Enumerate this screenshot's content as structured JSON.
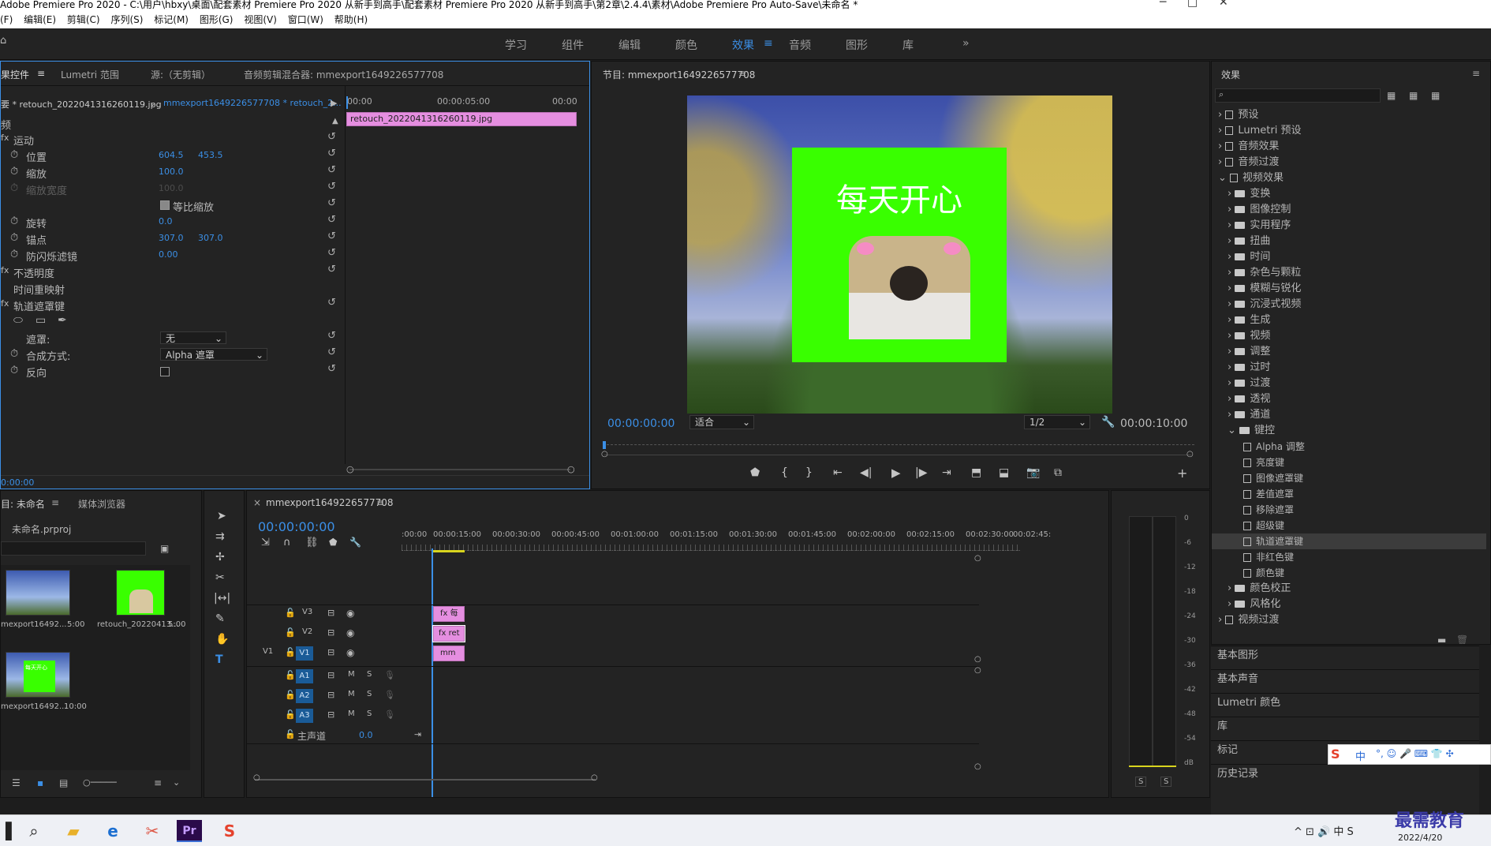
{
  "window": {
    "title": "Adobe Premiere Pro 2020 - C:\\用户\\hbxy\\桌面\\配套素材 Premiere Pro 2020 从新手到高手\\配套素材 Premiere Pro 2020 从新手到高手\\第2章\\2.4.4\\素材\\Adobe Premiere Pro Auto-Save\\未命名 *"
  },
  "menu": [
    "(F)",
    "编辑(E)",
    "剪辑(C)",
    "序列(S)",
    "标记(M)",
    "图形(G)",
    "视图(V)",
    "窗口(W)",
    "帮助(H)"
  ],
  "workspaces": [
    "学习",
    "组件",
    "编辑",
    "颜色",
    "效果",
    "音频",
    "图形",
    "库"
  ],
  "workspace_active": "效果",
  "effect_controls": {
    "tabs": [
      "果控件",
      "Lumetri 范围",
      "源:（无剪辑）",
      "音频剪辑混合器: mmexport1649226577708"
    ],
    "source_clip": "要 * retouch_2022041316260119.jpg",
    "sequence_clip": "mmexport1649226577708 * retouch_2...",
    "section": "频",
    "timeline_start": "00:00",
    "timeline_mid": "00:00:05:00",
    "timeline_end": "00:00",
    "clip_label": "retouch_2022041316260119.jpg",
    "timecode": "0:00:00",
    "props": {
      "motion": "运动",
      "position": "位置",
      "pos_x": "604.5",
      "pos_y": "453.5",
      "scale": "缩放",
      "scale_val": "100.0",
      "scale_width": "缩放宽度",
      "scale_width_val": "100.0",
      "uniform": "等比缩放",
      "rotation": "旋转",
      "rotation_val": "0.0",
      "anchor": "锚点",
      "anchor_x": "307.0",
      "anchor_y": "307.0",
      "flicker": "防闪烁滤镜",
      "flicker_val": "0.00",
      "opacity": "不透明度",
      "time_remap": "时间重映射",
      "track_matte": "轨道遮罩键",
      "mask": "遮罩:",
      "mask_val": "无",
      "composite": "合成方式:",
      "composite_val": "Alpha 遮罩",
      "reverse": "反向"
    }
  },
  "program": {
    "title": "节目: mmexport1649226577708",
    "overlay_text": "每天开心",
    "timecode": "00:00:00:00",
    "fit": "适合",
    "resolution": "1/2",
    "duration": "00:00:10:00"
  },
  "effects": {
    "title": "效果",
    "items": [
      "预设",
      "Lumetri 预设",
      "音频效果",
      "音频过渡",
      "视频效果"
    ],
    "video_effects": [
      "变换",
      "图像控制",
      "实用程序",
      "扭曲",
      "时间",
      "杂色与颗粒",
      "模糊与锐化",
      "沉浸式视频",
      "生成",
      "视频",
      "调整",
      "过时",
      "过渡",
      "透视",
      "通道",
      "键控"
    ],
    "keying": [
      "Alpha 调整",
      "亮度键",
      "图像遮罩键",
      "差值遮罩",
      "移除遮罩",
      "超级键",
      "轨道遮罩键",
      "非红色键",
      "颜色键"
    ],
    "keying_selected": "轨道遮罩键",
    "after": [
      "颜色校正",
      "风格化"
    ],
    "last": "视频过渡",
    "side_panels": [
      "基本图形",
      "基本声音",
      "Lumetri 颜色",
      "库",
      "标记",
      "历史记录"
    ]
  },
  "project": {
    "tabs": [
      "目: 未命名",
      "媒体浏览器"
    ],
    "file": "未命名.prproj",
    "items": [
      {
        "name": "mexport16492...",
        "dur": "5:00"
      },
      {
        "name": "retouch_20220413...",
        "dur": "5:00"
      },
      {
        "name": "mexport16492...",
        "dur": "10:00"
      }
    ],
    "thumb_text": "每天开心"
  },
  "timeline": {
    "title": "mmexport1649226577708",
    "timecode": "00:00:00:00",
    "ruler": [
      ":00:00",
      "00:00:15:00",
      "00:00:30:00",
      "00:00:45:00",
      "00:01:00:00",
      "00:01:15:00",
      "00:01:30:00",
      "00:01:45:00",
      "00:02:00:00",
      "00:02:15:00",
      "00:02:30:00",
      "00:02:45:"
    ],
    "tracks": [
      "V3",
      "V2",
      "V1",
      "A1",
      "A2",
      "A3"
    ],
    "v1_source": "V1",
    "master": "主声道",
    "master_val": "0.0",
    "m": "M",
    "s": "S",
    "clips": [
      "fx 每",
      "fx ret",
      "mm"
    ]
  },
  "meter": {
    "scale": [
      "0",
      "-6",
      "-12",
      "-18",
      "-24",
      "-30",
      "-36",
      "-42",
      "-48",
      "-54",
      "dB"
    ],
    "solo": "S"
  },
  "ime": {
    "text": "中"
  },
  "watermark": "最需教育",
  "taskbar": {
    "date": "2022/4/20"
  },
  "colors": {
    "accent": "#3b8fe6",
    "clip": "#e58ee0",
    "green_screen": "#39ff00"
  }
}
